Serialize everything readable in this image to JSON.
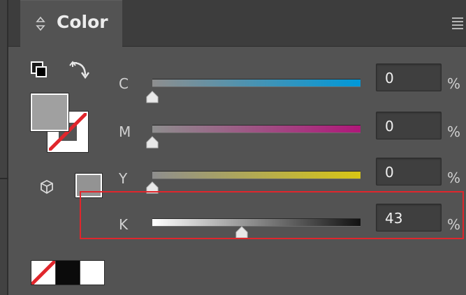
{
  "panel": {
    "title": "Color",
    "tab_arrows": "⬦",
    "menu_icon": "menu-icon"
  },
  "swatches": {
    "fill_color": "#a0a0a0",
    "stroke": "none",
    "small_swatch_color": "#939393",
    "quick_swatches": [
      "none",
      "#000000",
      "#ffffff"
    ]
  },
  "channels": [
    {
      "label": "C",
      "value": "0",
      "unit": "%",
      "level": 0,
      "gradient": [
        "#8e8e8e",
        "#0098d8"
      ]
    },
    {
      "label": "M",
      "value": "0",
      "unit": "%",
      "level": 0,
      "gradient": [
        "#8e8e8e",
        "#b0177a"
      ]
    },
    {
      "label": "Y",
      "value": "0",
      "unit": "%",
      "level": 0,
      "gradient": [
        "#8e8e8e",
        "#d8c615"
      ]
    },
    {
      "label": "K",
      "value": "43",
      "unit": "%",
      "level": 43,
      "gradient": [
        "#ffffff",
        "#111111"
      ]
    }
  ],
  "highlight_color": "#e0262c"
}
